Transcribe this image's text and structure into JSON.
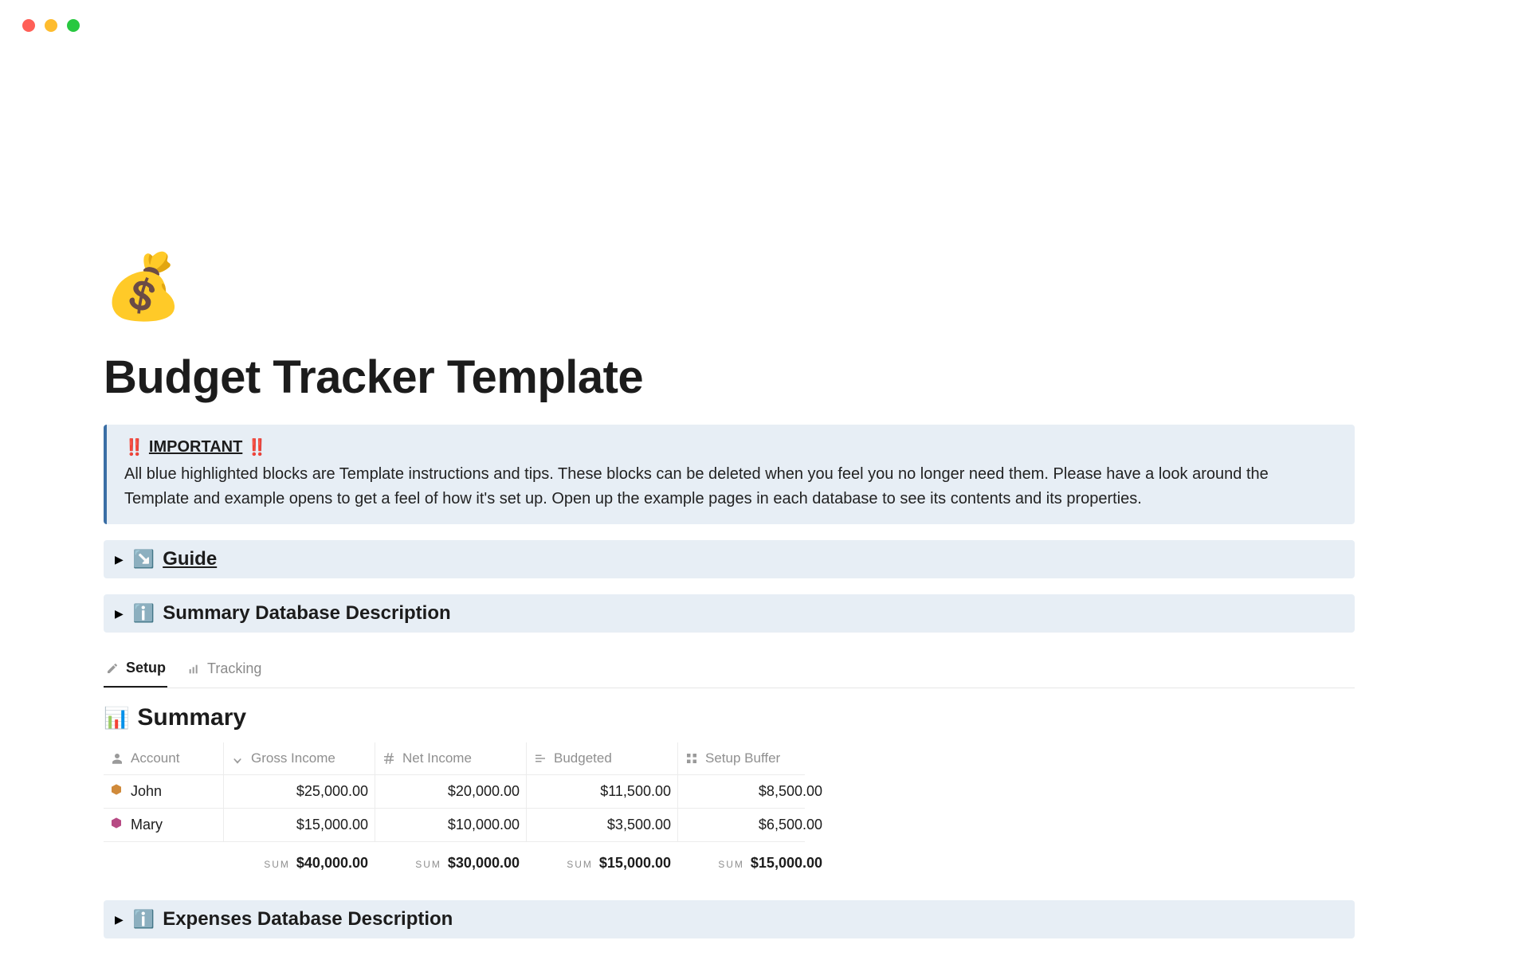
{
  "window": {
    "traffic": [
      "red",
      "yellow",
      "green"
    ]
  },
  "icon": "💰",
  "title": "Budget Tracker Template",
  "callout": {
    "leading": "‼️",
    "trailing": "‼️",
    "important_label": "IMPORTANT",
    "body": "All blue highlighted blocks are Template instructions and tips. These blocks can be deleted when you feel you no longer need them. Please have a look around the Template and example opens to get a feel of how it's set up. Open up the example pages in each database to see its contents and its properties."
  },
  "toggles": {
    "guide": {
      "emoji": "↘️",
      "label": "Guide"
    },
    "summary_desc": {
      "emoji": "ℹ️",
      "label": "Summary Database Description"
    },
    "expenses_desc": {
      "emoji": "ℹ️",
      "label": "Expenses Database Description"
    }
  },
  "tabs": {
    "setup": "Setup",
    "tracking": "Tracking"
  },
  "summary": {
    "emoji": "📊",
    "heading": "Summary",
    "columns": {
      "account": "Account",
      "gross": "Gross Income",
      "net": "Net Income",
      "budgeted": "Budgeted",
      "buffer": "Setup Buffer"
    },
    "rows": [
      {
        "name": "John",
        "color": "#d08a3a",
        "gross": "$25,000.00",
        "net": "$20,000.00",
        "budgeted": "$11,500.00",
        "buffer": "$8,500.00"
      },
      {
        "name": "Mary",
        "color": "#b74a84",
        "gross": "$15,000.00",
        "net": "$10,000.00",
        "budgeted": "$3,500.00",
        "buffer": "$6,500.00"
      }
    ],
    "sums": {
      "label": "SUM",
      "gross": "$40,000.00",
      "net": "$30,000.00",
      "budgeted": "$15,000.00",
      "buffer": "$15,000.00"
    }
  }
}
